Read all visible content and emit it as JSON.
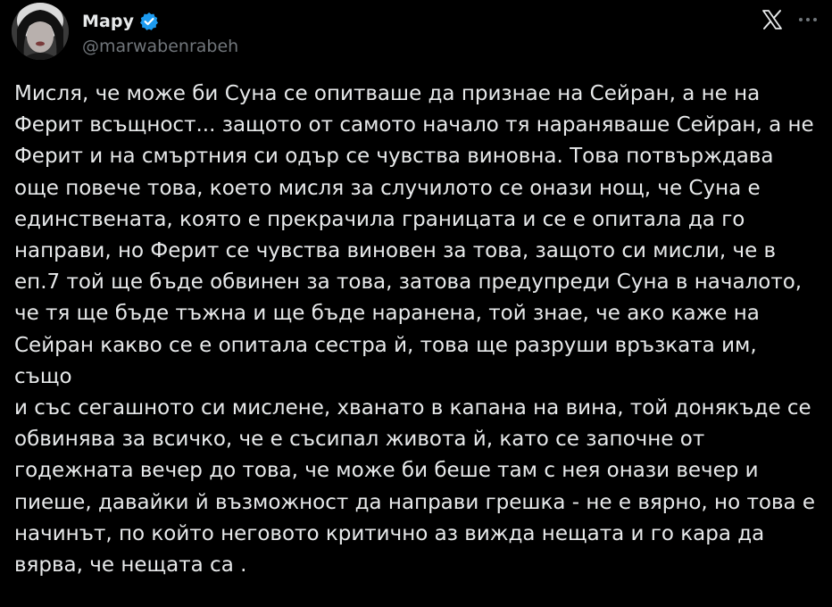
{
  "author": {
    "display_name": "Мару",
    "handle": "@marwabenrabeh",
    "verified": true,
    "avatar": "avatar-photo"
  },
  "icons": {
    "verified": "verified-badge-icon",
    "platform": "x-logo-icon",
    "more": "more-options-icon"
  },
  "colors": {
    "background": "#000000",
    "text": "#e7e9ea",
    "secondary_text": "#71767b",
    "verified_blue": "#1d9bf0"
  },
  "tweet": {
    "text": "Мисля, че може би Суна се опитваше да признае на Сейран, а не на\nФерит всъщност... защото от самото начало тя нараняваше Сейран, а не\nФерит и на смъртния си одър се чувства виновна. Това потвърждава\nоще повече това, което мисля за случилото се онази нощ, че Суна е\nединствената, която е прекрачила границата и се е опитала да го\nнаправи, но Ферит се чувства виновен за това, защото си мисли, че в\nеп.7 той ще бъде обвинен за това, затова предупреди Суна в началото,\nче тя ще бъде тъжна и ще бъде наранена, той знае, че ако каже на\nСейран какво се е опитала сестра й, това ще разруши връзката им, също\nи със сегашното си мислене, хванато в капана на вина, той донякъде се\nобвинява за всичко, че е съсипал живота й, като се започне от\nгодежната вечер до това, че може би беше там с нея онази вечер и\nпиеше, давайки й възможност да направи грешка - не е вярно, но това е\nначинът, по който неговото критично аз вижда нещата и го кара да\nвярва, че нещата са ."
  }
}
